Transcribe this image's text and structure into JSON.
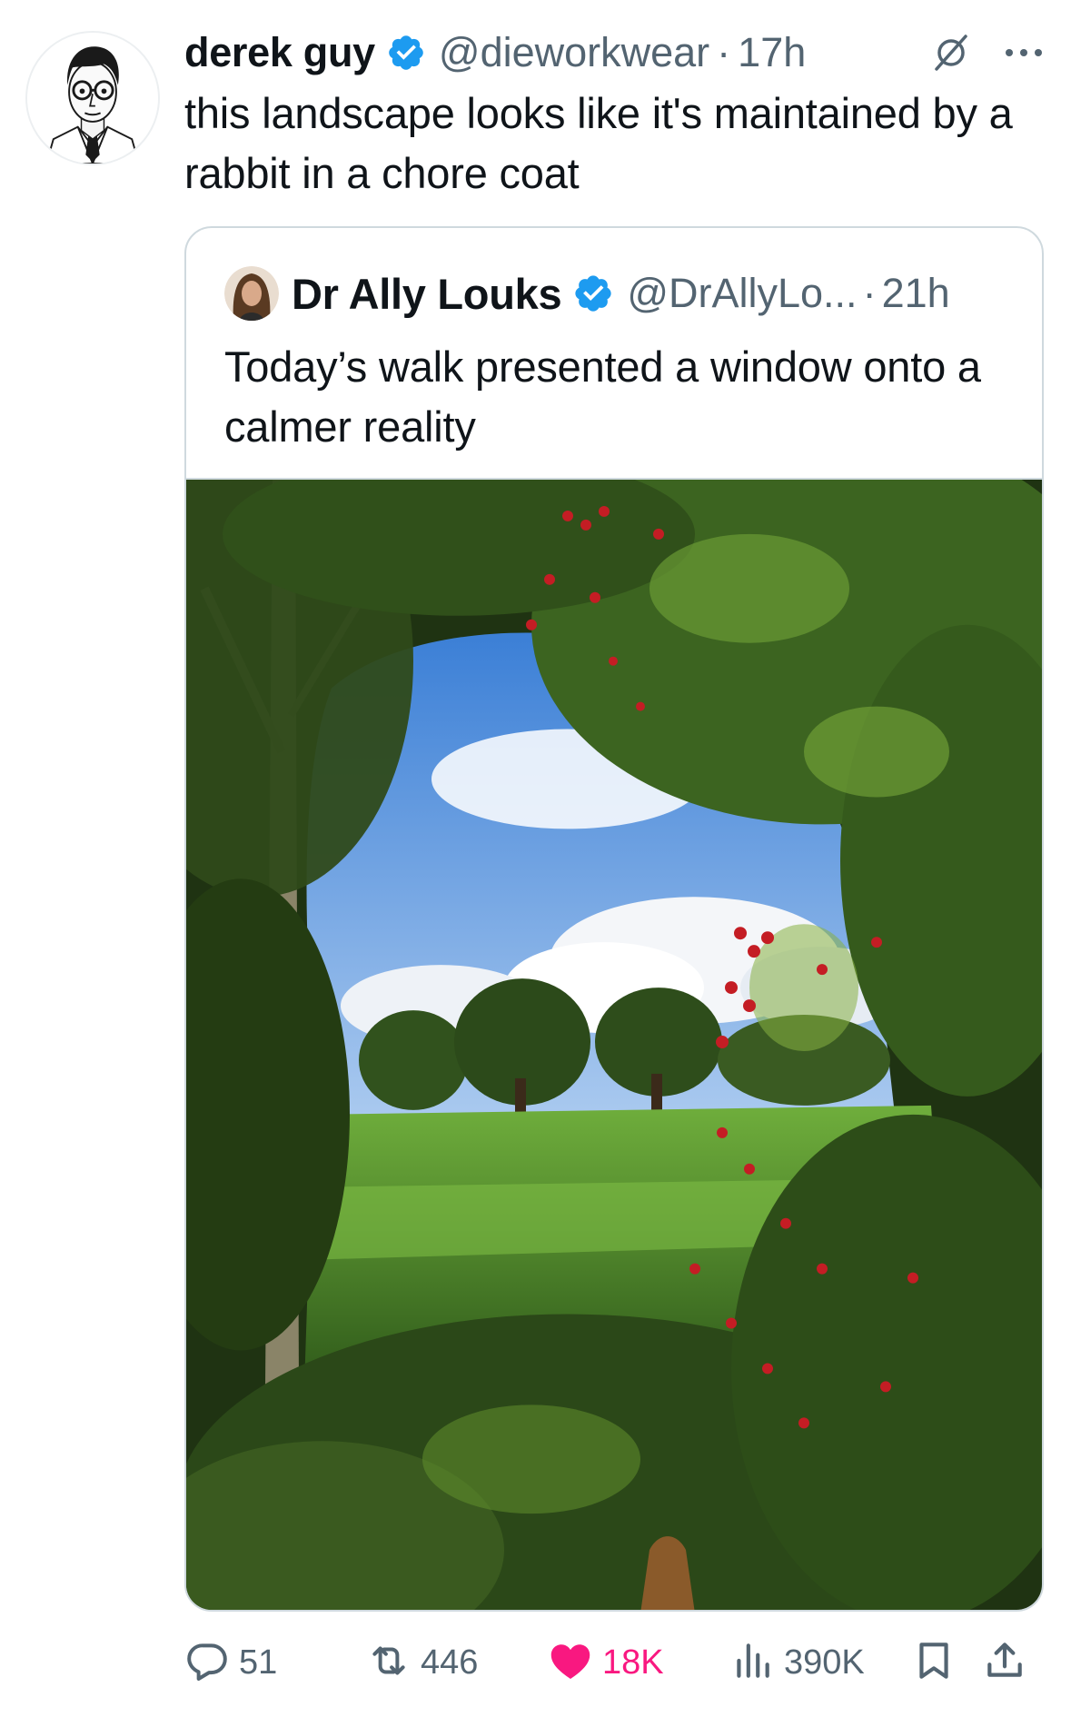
{
  "tweet": {
    "author": {
      "name": "derek guy",
      "handle": "@dieworkwear",
      "time": "17h",
      "avatar_icon": "illustrated-man-avatar"
    },
    "text": "this landscape looks like it's maintained by a rabbit in a chore coat",
    "separator": "·",
    "icons": {
      "verified": "verified-badge-icon",
      "grok": "grok-icon",
      "more": "more-options-icon"
    }
  },
  "quote": {
    "author": {
      "name": "Dr Ally Louks",
      "handle": "@DrAllyLo...",
      "time": "21h"
    },
    "separator": "·",
    "text": "Today’s walk presented a window onto a calmer reality",
    "media_icon": "landscape-photo"
  },
  "actions": {
    "reply": {
      "count": "51",
      "icon": "reply-icon"
    },
    "repost": {
      "count": "446",
      "icon": "repost-icon"
    },
    "like": {
      "count": "18K",
      "icon": "heart-filled-icon",
      "color": "#f91880"
    },
    "views": {
      "count": "390K",
      "icon": "views-chart-icon"
    },
    "bookmark": {
      "icon": "bookmark-icon"
    },
    "share": {
      "icon": "share-icon"
    }
  },
  "colors": {
    "text": "#0f1419",
    "secondary": "#536471",
    "verified": "#1d9bf0",
    "like": "#f91880",
    "border": "#cfd9de"
  }
}
